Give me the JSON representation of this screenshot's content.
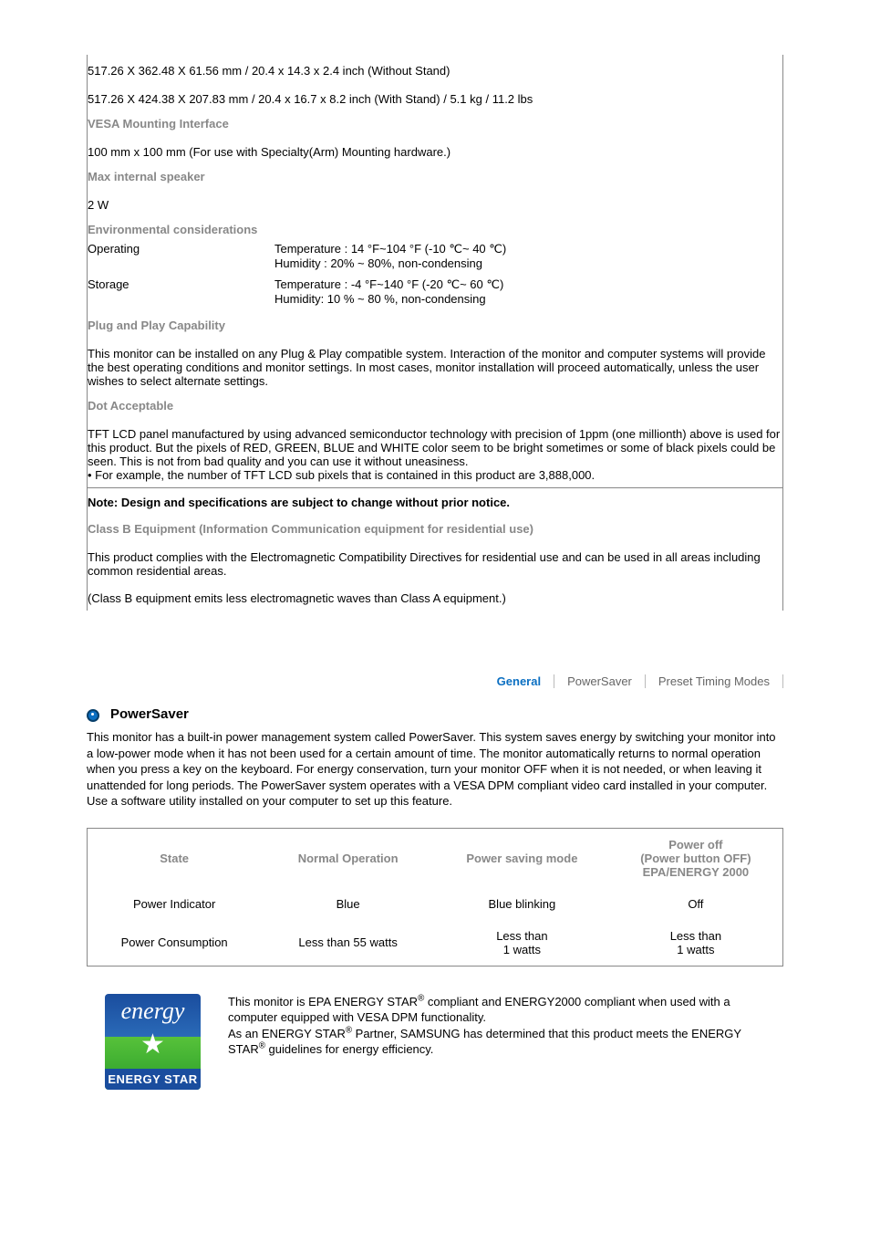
{
  "spec": {
    "dim_without_stand": "517.26 X 362.48 X 61.56 mm / 20.4 x 14.3 x 2.4 inch (Without Stand)",
    "dim_with_stand": "517.26 X 424.38 X 207.83 mm / 20.4 x 16.7 x 8.2 inch (With Stand) / 5.1 kg / 11.2 lbs",
    "vesa_heading": "VESA Mounting Interface",
    "vesa_value": "100 mm x 100 mm (For use with Specialty(Arm) Mounting hardware.)",
    "max_speaker_heading": "Max internal speaker",
    "max_speaker_value": "2 W",
    "env_heading": "Environmental considerations",
    "env_operating_label": "Operating",
    "env_operating_temp": "Temperature : 14 °F~104 °F (-10 ℃~ 40 ℃)",
    "env_operating_humidity": "Humidity : 20% ~ 80%, non-condensing",
    "env_storage_label": "Storage",
    "env_storage_temp": "Temperature : -4 °F~140 °F (-20 ℃~ 60 ℃)",
    "env_storage_humidity": "Humidity: 10 % ~ 80 %, non-condensing",
    "pnp_heading": "Plug and Play Capability",
    "pnp_body": "This monitor can be installed on any Plug & Play compatible system. Interaction of the monitor and computer systems will provide the best operating conditions and monitor settings. In most cases, monitor installation will proceed automatically, unless the user wishes to select alternate settings.",
    "dot_heading": "Dot Acceptable",
    "dot_body": "TFT LCD panel manufactured by using advanced semiconductor technology with precision of 1ppm (one millionth) above is used for this product. But the pixels of RED, GREEN, BLUE and WHITE color seem to be bright sometimes or some of black pixels could be seen. This is not from bad quality and you can use it without uneasiness.",
    "dot_bullet": "For example, the number of TFT LCD sub pixels that is contained in this product are 3,888,000.",
    "note": "Note: Design and specifications are subject to change without prior notice.",
    "classb_heading": "Class B Equipment (Information Communication equipment for residential use)",
    "classb_body1": "This product complies with the Electromagnetic Compatibility Directives for residential use and can be used in all areas including common residential areas.",
    "classb_body2": "(Class B equipment emits less electromagnetic waves than Class A equipment.)"
  },
  "tabs": {
    "general": "General",
    "powersaver": "PowerSaver",
    "preset": "Preset Timing Modes"
  },
  "powersaver": {
    "title": "PowerSaver",
    "desc": "This monitor has a built-in power management system called PowerSaver. This system saves energy by switching your monitor into a low-power mode when it has not been used for a certain amount of time. The monitor automatically returns to normal operation when you press a key on the keyboard. For energy conservation, turn your monitor OFF when it is not needed, or when leaving it unattended for long periods. The PowerSaver system operates with a VESA DPM compliant video card installed in your computer. Use a software utility installed on your computer to set up this feature.",
    "table": {
      "h_state": "State",
      "h_normal": "Normal Operation",
      "h_saving": "Power saving mode",
      "h_off_l1": "Power off",
      "h_off_l2": "(Power button OFF)",
      "h_off_l3": "EPA/ENERGY 2000",
      "r1_label": "Power Indicator",
      "r1_normal": "Blue",
      "r1_saving": "Blue blinking",
      "r1_off": "Off",
      "r2_label": "Power Consumption",
      "r2_normal": "Less than 55 watts",
      "r2_saving_l1": "Less than",
      "r2_saving_l2": "1 watts",
      "r2_off_l1": "Less than",
      "r2_off_l2": "1 watts"
    },
    "logo_script": "energy",
    "logo_label": "ENERGY STAR",
    "energy_p1a": "This monitor is EPA ENERGY STAR",
    "energy_p1b": " compliant and ENERGY2000 compliant when used with a computer equipped with VESA DPM functionality.",
    "energy_p2a": "As an ENERGY STAR",
    "energy_p2b": " Partner, SAMSUNG has determined that this product meets the ENERGY STAR",
    "energy_p2c": " guidelines for energy efficiency."
  }
}
